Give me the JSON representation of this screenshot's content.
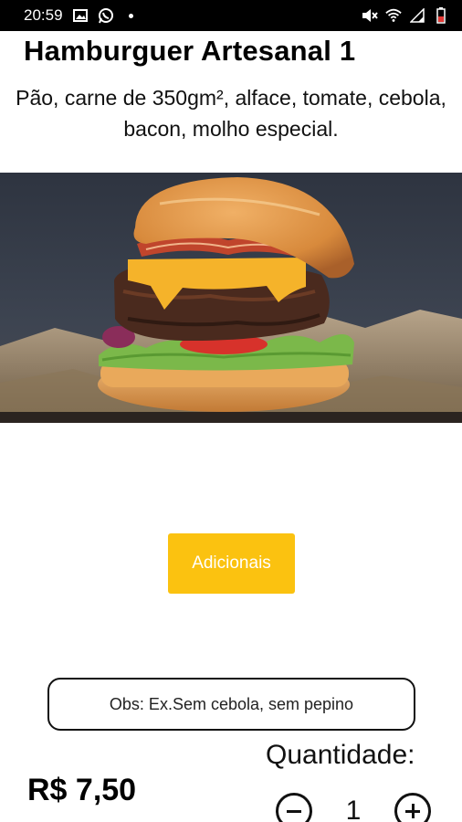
{
  "status_bar": {
    "time": "20:59",
    "left_icons": [
      "image-icon",
      "whatsapp-icon",
      "dot-icon"
    ],
    "right_icons": [
      "mute-icon",
      "wifi-icon",
      "signal-icon",
      "battery-icon"
    ]
  },
  "product": {
    "title": "Hamburguer Artesanal 1",
    "description": "Pão, carne de 350gm², alface, tomate, cebola, bacon, molho especial.",
    "image": "hamburger-photo"
  },
  "actions": {
    "adicionais_label": "Adicionais"
  },
  "obs": {
    "placeholder": "Obs: Ex.Sem cebola, sem pepino",
    "value": ""
  },
  "order": {
    "price": "R$ 7,50",
    "quantity_label": "Quantidade:",
    "quantity": "1"
  },
  "colors": {
    "accent": "#fbc210",
    "status_bar": "#000000"
  }
}
